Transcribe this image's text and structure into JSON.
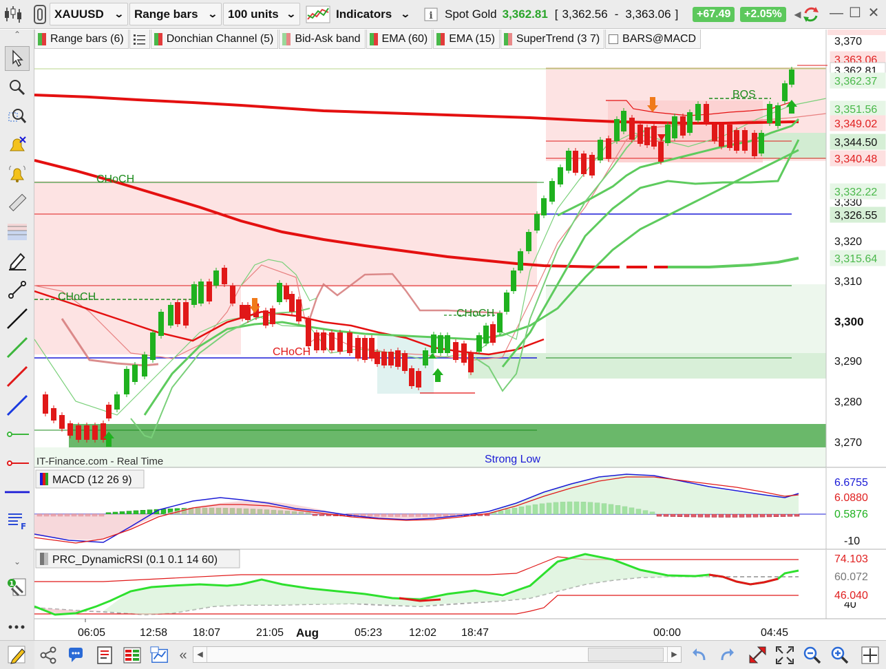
{
  "toolbar": {
    "symbol": "XAUUSD",
    "bar_type": "Range bars",
    "units": "100 units",
    "indicators_label": "Indicators",
    "instrument_name": "Spot Gold",
    "last_price": "3,362.81",
    "bid_ask_open": "[",
    "bid": "3,362.56",
    "dash": "-",
    "ask": "3,363.06",
    "bid_ask_close": "]",
    "change_abs": "+67.49",
    "change_pct": "+2.05%"
  },
  "legend": [
    {
      "label": "Range bars (6)",
      "colors": [
        "#e23b3b",
        "#4ab84a"
      ]
    },
    {
      "label": "Donchian Channel (5)",
      "colors": [
        "#4ab84a",
        "#e23b3b"
      ]
    },
    {
      "label": "Bid-Ask band",
      "colors": [
        "#e88888",
        "#9ad89a"
      ]
    },
    {
      "label": "EMA (60)",
      "colors": [
        "#e23b3b",
        "#4ab84a"
      ]
    },
    {
      "label": "EMA (15)",
      "colors": [
        "#4ab84a",
        "#e23b3b"
      ]
    },
    {
      "label": "SuperTrend (3 7)",
      "colors": [
        "#4ab84a",
        "#e88888"
      ]
    },
    {
      "label": "BARS@MACD",
      "colors": []
    }
  ],
  "colors": {
    "bull": "#1fb11f",
    "bear": "#e01818",
    "ema60": "#e41010",
    "ema15_up": "#5ecb5e",
    "support_fill": "#6fbf6f",
    "resistance_fill": "#fde3e3",
    "blue_line": "#1a1ad6",
    "rsi_line": "#2ee02e"
  },
  "chart": {
    "watermark": "IT-Finance.com - Real Time",
    "labels": {
      "choch1": "CHoCH",
      "choch2": "CHoCH",
      "choch3": "CHoCH",
      "choch4": "CHoCH",
      "bos": "BOS",
      "strong_low": "Strong Low"
    },
    "price_axis": [
      "3,370",
      "3,330",
      "3,320",
      "3,310",
      "3,300",
      "3,290",
      "3,280",
      "3,270"
    ],
    "price_tags": [
      {
        "text": "3,363.06",
        "bg": "#fde0e0",
        "fg": "#e02020"
      },
      {
        "text": "3,362.81",
        "bg": "#ffffff",
        "fg": "#111111"
      },
      {
        "text": "3,362.37",
        "bg": "#e6f6e6",
        "fg": "#4ab84a"
      },
      {
        "text": "3,351.56",
        "bg": "#e6f6e6",
        "fg": "#4ab84a"
      },
      {
        "text": "3,349.02",
        "bg": "#fde0e0",
        "fg": "#e02020"
      },
      {
        "text": "3,344.50",
        "bg": "#d6efd6",
        "fg": "#111111"
      },
      {
        "text": "3,340.48",
        "bg": "#fde0e0",
        "fg": "#e02020"
      },
      {
        "text": "3,332.22",
        "bg": "#e6f6e6",
        "fg": "#4ab84a"
      },
      {
        "text": "3,326.55",
        "bg": "#d6efd6",
        "fg": "#111111"
      },
      {
        "text": "3,315.64",
        "bg": "#e6f6e6",
        "fg": "#4ab84a"
      }
    ]
  },
  "macd": {
    "title": "MACD (12 26 9)",
    "axis": [
      "-10"
    ],
    "tags": [
      {
        "text": "6.6755",
        "bg": "#ffffff",
        "fg": "#1a1ad6"
      },
      {
        "text": "6.0880",
        "bg": "#ffffff",
        "fg": "#e02020"
      },
      {
        "text": "0.5876",
        "bg": "#ffffff",
        "fg": "#1fb11f"
      }
    ]
  },
  "rsi": {
    "title": "PRC_DynamicRSI (0.1 0.1 14 60)",
    "axis": [
      "40"
    ],
    "tags": [
      {
        "text": "74.103",
        "bg": "#ffffff",
        "fg": "#e02020"
      },
      {
        "text": "60.072",
        "bg": "#ffffff",
        "fg": "#777777"
      },
      {
        "text": "46.040",
        "bg": "#ffffff",
        "fg": "#e02020"
      }
    ]
  },
  "time_axis": [
    "06:05",
    "12:58",
    "18:07",
    "21:05",
    "Aug",
    "05:23",
    "12:02",
    "18:47",
    "00:00",
    "04:45"
  ]
}
